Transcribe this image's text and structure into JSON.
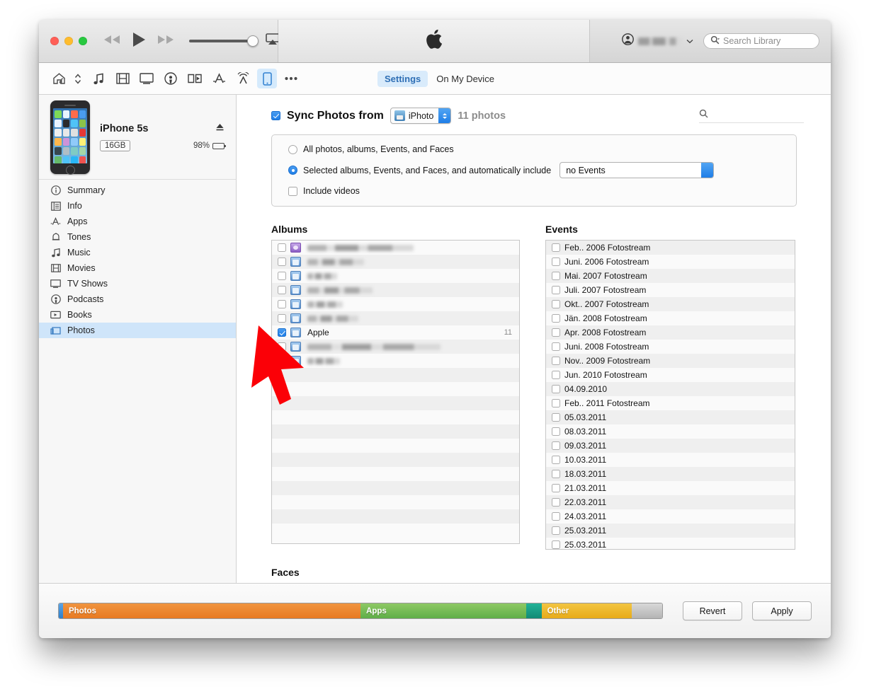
{
  "window": {
    "traffic_lights": [
      "close",
      "minimize",
      "zoom"
    ],
    "colors": {
      "accent_blue": "#1f7fe8",
      "selection_blue": "#cfe5fa",
      "photos_orange": "#ef8733",
      "apps_green": "#77bb55",
      "other_yellow": "#eeb72a",
      "free_gray": "#bdbdbd",
      "cursor_red": "#fb0007"
    }
  },
  "titlebar": {
    "transport": {
      "rewind_icon": "rewind-icon",
      "play_icon": "play-icon",
      "forward_icon": "fast-forward-icon",
      "volume_icon": "volume-slider",
      "volume_value": 93,
      "airplay_icon": "airplay-icon"
    },
    "apple_logo_icon": "apple-logo-icon",
    "account": {
      "avatar_icon": "account-avatar-icon",
      "name": "",
      "chevron_icon": "chevron-down-icon"
    },
    "search": {
      "icon": "search-icon",
      "placeholder": "Search Library",
      "value": ""
    }
  },
  "navbar": {
    "icons": [
      {
        "name": "home-icon",
        "active": false
      },
      {
        "name": "updown-chevrons-icon",
        "active": false
      },
      {
        "name": "music-note-icon",
        "active": false
      },
      {
        "name": "film-icon",
        "active": false
      },
      {
        "name": "tv-icon",
        "active": false
      },
      {
        "name": "podcast-icon",
        "active": false
      },
      {
        "name": "book-icon",
        "active": false
      },
      {
        "name": "app-store-icon",
        "active": false
      },
      {
        "name": "radio-icon",
        "active": false
      },
      {
        "name": "iphone-device-icon",
        "active": true
      },
      {
        "name": "more-ellipsis-icon",
        "active": false
      }
    ],
    "tabs": [
      {
        "label": "Settings",
        "selected": true
      },
      {
        "label": "On My Device",
        "selected": false
      }
    ]
  },
  "sidebar": {
    "device": {
      "name": "iPhone 5s",
      "capacity": "16GB",
      "battery_percent": "98%",
      "eject_icon": "eject-icon",
      "battery_icon": "battery-icon",
      "thumbnail_icon": "iphone-thumbnail"
    },
    "items": [
      {
        "label": "Summary",
        "icon": "info-circle-icon",
        "selected": false
      },
      {
        "label": "Info",
        "icon": "contact-card-icon",
        "selected": false
      },
      {
        "label": "Apps",
        "icon": "app-store-icon",
        "selected": false
      },
      {
        "label": "Tones",
        "icon": "bell-icon",
        "selected": false
      },
      {
        "label": "Music",
        "icon": "music-note-icon",
        "selected": false
      },
      {
        "label": "Movies",
        "icon": "film-icon",
        "selected": false
      },
      {
        "label": "TV Shows",
        "icon": "tv-icon",
        "selected": false
      },
      {
        "label": "Podcasts",
        "icon": "podcast-icon",
        "selected": false
      },
      {
        "label": "Books",
        "icon": "book-icon",
        "selected": false
      },
      {
        "label": "Photos",
        "icon": "photos-icon",
        "selected": true
      }
    ]
  },
  "main": {
    "sync": {
      "checkbox_checked": true,
      "title": "Sync Photos from",
      "source_label": "iPhoto",
      "source_icon": "iphoto-app-icon",
      "photo_count": "11 photos",
      "search_icon": "search-icon",
      "search_value": ""
    },
    "options": {
      "radio_all": {
        "label": "All photos, albums, Events, and Faces",
        "selected": false
      },
      "radio_selected": {
        "label": "Selected albums, Events, and Faces, and automatically include",
        "selected": true
      },
      "auto_include_value": "no Events",
      "include_videos": {
        "label": "Include videos",
        "checked": false
      }
    },
    "albums": {
      "header": "Albums",
      "rows": [
        {
          "label": "",
          "blurred": true,
          "blur_width": 150,
          "icon": "smart-album-icon",
          "checked": false,
          "count": ""
        },
        {
          "label": "",
          "blurred": true,
          "blur_width": 80,
          "icon": "album-icon",
          "checked": false,
          "count": ""
        },
        {
          "label": "",
          "blurred": true,
          "blur_width": 42,
          "icon": "album-icon",
          "checked": false,
          "count": ""
        },
        {
          "label": "",
          "blurred": true,
          "blur_width": 92,
          "icon": "album-icon",
          "checked": false,
          "count": ""
        },
        {
          "label": "",
          "blurred": true,
          "blur_width": 50,
          "icon": "album-icon",
          "checked": false,
          "count": ""
        },
        {
          "label": "",
          "blurred": true,
          "blur_width": 72,
          "icon": "album-icon",
          "checked": false,
          "count": ""
        },
        {
          "label": "Apple",
          "blurred": false,
          "blur_width": 0,
          "icon": "album-icon",
          "checked": true,
          "count": "11"
        },
        {
          "label": "",
          "blurred": true,
          "blur_width": 188,
          "icon": "album-icon",
          "checked": false,
          "count": ""
        },
        {
          "label": "",
          "blurred": true,
          "blur_width": 46,
          "icon": "album-icon",
          "checked": false,
          "count": ""
        }
      ],
      "empty_rows": 12
    },
    "events": {
      "header": "Events",
      "rows": [
        {
          "label": "Feb.. 2006 Fotostream",
          "checked": false
        },
        {
          "label": "Juni. 2006 Fotostream",
          "checked": false
        },
        {
          "label": "Mai. 2007 Fotostream",
          "checked": false
        },
        {
          "label": "Juli. 2007 Fotostream",
          "checked": false
        },
        {
          "label": "Okt.. 2007 Fotostream",
          "checked": false
        },
        {
          "label": "Jän. 2008 Fotostream",
          "checked": false
        },
        {
          "label": "Apr. 2008 Fotostream",
          "checked": false
        },
        {
          "label": "Juni. 2008 Fotostream",
          "checked": false
        },
        {
          "label": "Nov.. 2009 Fotostream",
          "checked": false
        },
        {
          "label": "Jun. 2010 Fotostream",
          "checked": false
        },
        {
          "label": "04.09.2010",
          "checked": false
        },
        {
          "label": "Feb.. 2011 Fotostream",
          "checked": false
        },
        {
          "label": "05.03.2011",
          "checked": false
        },
        {
          "label": "08.03.2011",
          "checked": false
        },
        {
          "label": "09.03.2011",
          "checked": false
        },
        {
          "label": "10.03.2011",
          "checked": false
        },
        {
          "label": "18.03.2011",
          "checked": false
        },
        {
          "label": "21.03.2011",
          "checked": false
        },
        {
          "label": "22.03.2011",
          "checked": false
        },
        {
          "label": "24.03.2011",
          "checked": false
        },
        {
          "label": "25.03.2011",
          "checked": false
        },
        {
          "label": "25.03.2011",
          "checked": false
        }
      ]
    },
    "faces": {
      "header": "Faces",
      "rows": [
        {
          "label": "",
          "blurred": true,
          "blur_width": 130,
          "icon": "face-icon",
          "checked": false
        }
      ]
    }
  },
  "bottom": {
    "capacity_segments": [
      {
        "label": "",
        "color": "#3e8fd8",
        "percent": 0.7
      },
      {
        "label": "Photos",
        "color": "#ef8733",
        "percent": 49.3
      },
      {
        "label": "Apps",
        "color": "#77bb55",
        "percent": 27.5
      },
      {
        "label": "",
        "color": "#19a389",
        "percent": 2.5
      },
      {
        "label": "Other",
        "color": "#eeb72a",
        "percent": 15.0
      },
      {
        "label": "",
        "color": "#bdbdbd",
        "percent": 5.0
      }
    ],
    "revert_label": "Revert",
    "apply_label": "Apply"
  }
}
